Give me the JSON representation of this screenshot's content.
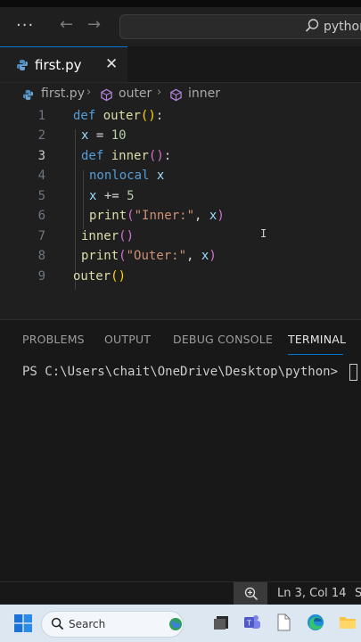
{
  "titlebar": {
    "menu_label": "···",
    "back_icon": "arrow-left-icon",
    "forward_icon": "arrow-right-icon",
    "command_center_text": "python"
  },
  "tabs": [
    {
      "label": "first.py",
      "icon": "python-file-icon",
      "active": true,
      "close_glyph": "✕"
    }
  ],
  "breadcrumb": {
    "file": "first.py",
    "symbol1": "outer",
    "symbol2": "inner"
  },
  "editor": {
    "active_line": 3,
    "lines": [
      {
        "n": "1",
        "text": "def outer():"
      },
      {
        "n": "2",
        "text": "x = 10"
      },
      {
        "n": "3",
        "text": "def inner():"
      },
      {
        "n": "4",
        "text": "nonlocal x"
      },
      {
        "n": "5",
        "text": "x += 5"
      },
      {
        "n": "6",
        "text": "print(\"Inner:\", x)"
      },
      {
        "n": "7",
        "text": "inner()"
      },
      {
        "n": "8",
        "text": "print(\"Outer:\", x)"
      },
      {
        "n": "9",
        "text": "outer()"
      }
    ],
    "tokens": {
      "l1": [
        "def",
        "outer",
        "()",
        ":"
      ],
      "l2": [
        "x",
        "=",
        "10"
      ],
      "l3": [
        "def",
        "inner",
        "()",
        ":"
      ],
      "l4": [
        "nonlocal",
        "x"
      ],
      "l5": [
        "x",
        "+=",
        "5"
      ],
      "l6": [
        "print",
        "(",
        "\"Inner:\"",
        ", ",
        "x",
        ")"
      ],
      "l7": [
        "inner",
        "()"
      ],
      "l8": [
        "print",
        "(",
        "\"Outer:\"",
        ", ",
        "x",
        ")"
      ],
      "l9": [
        "outer",
        "()"
      ]
    }
  },
  "panel": {
    "tabs": [
      "PROBLEMS",
      "OUTPUT",
      "DEBUG CONSOLE",
      "TERMINAL"
    ],
    "active_tab": "TERMINAL",
    "terminal_prompt": "PS C:\\Users\\chait\\OneDrive\\Desktop\\python>"
  },
  "statusbar": {
    "zoom_icon": "zoom-in-icon",
    "position": "Ln 3, Col 14",
    "extra": "S"
  },
  "taskbar": {
    "search_placeholder": "Search",
    "apps": [
      "start-icon",
      "task-view-icon",
      "teams-icon",
      "file-icon",
      "edge-icon",
      "file-explorer-icon"
    ]
  },
  "colors": {
    "accent": "#0078d4",
    "keyword": "#569cd6",
    "function": "#dcdcaa",
    "variable": "#9cdcfe",
    "number": "#b5cea8",
    "string": "#ce9178",
    "bracket_gold": "#ffd700",
    "bracket_purple": "#da70d6"
  }
}
